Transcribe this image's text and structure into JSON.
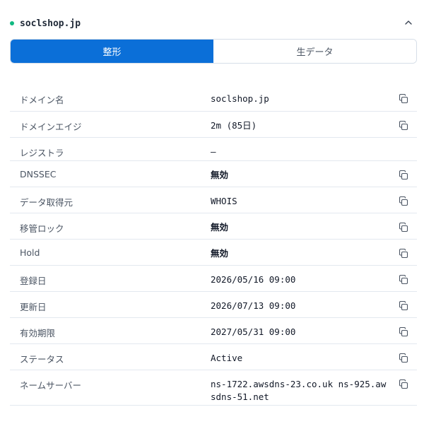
{
  "header": {
    "domain": "soclshop.jp",
    "status_color": "#10b981",
    "collapse_icon": "chevron-up-icon"
  },
  "tabs": [
    {
      "label": "整形",
      "active": true
    },
    {
      "label": "生データ",
      "active": false
    }
  ],
  "accent_color": "#0b6fd8",
  "rows": [
    {
      "label": "ドメイン名",
      "value": "soclshop.jp",
      "copy": true
    },
    {
      "label": "ドメインエイジ",
      "value": "2m (85日)",
      "copy": true
    },
    {
      "label": "レジストラ",
      "value": "–",
      "copy": false
    },
    {
      "label": "DNSSEC",
      "value": "無効",
      "copy": true
    },
    {
      "label": "データ取得元",
      "value": "WHOIS",
      "copy": true
    },
    {
      "label": "移管ロック",
      "value": "無効",
      "copy": true
    },
    {
      "label": "Hold",
      "value": "無効",
      "copy": true
    },
    {
      "label": "登録日",
      "value": "2026/05/16 09:00",
      "copy": true
    },
    {
      "label": "更新日",
      "value": "2026/07/13 09:00",
      "copy": true
    },
    {
      "label": "有効期限",
      "value": "2027/05/31 09:00",
      "copy": true
    },
    {
      "label": "ステータス",
      "value": "Active",
      "copy": true
    },
    {
      "label": "ネームサーバー",
      "value": "ns-1722.awsdns-23.co.uk ns-925.awsdns-51.net",
      "copy": true
    }
  ]
}
